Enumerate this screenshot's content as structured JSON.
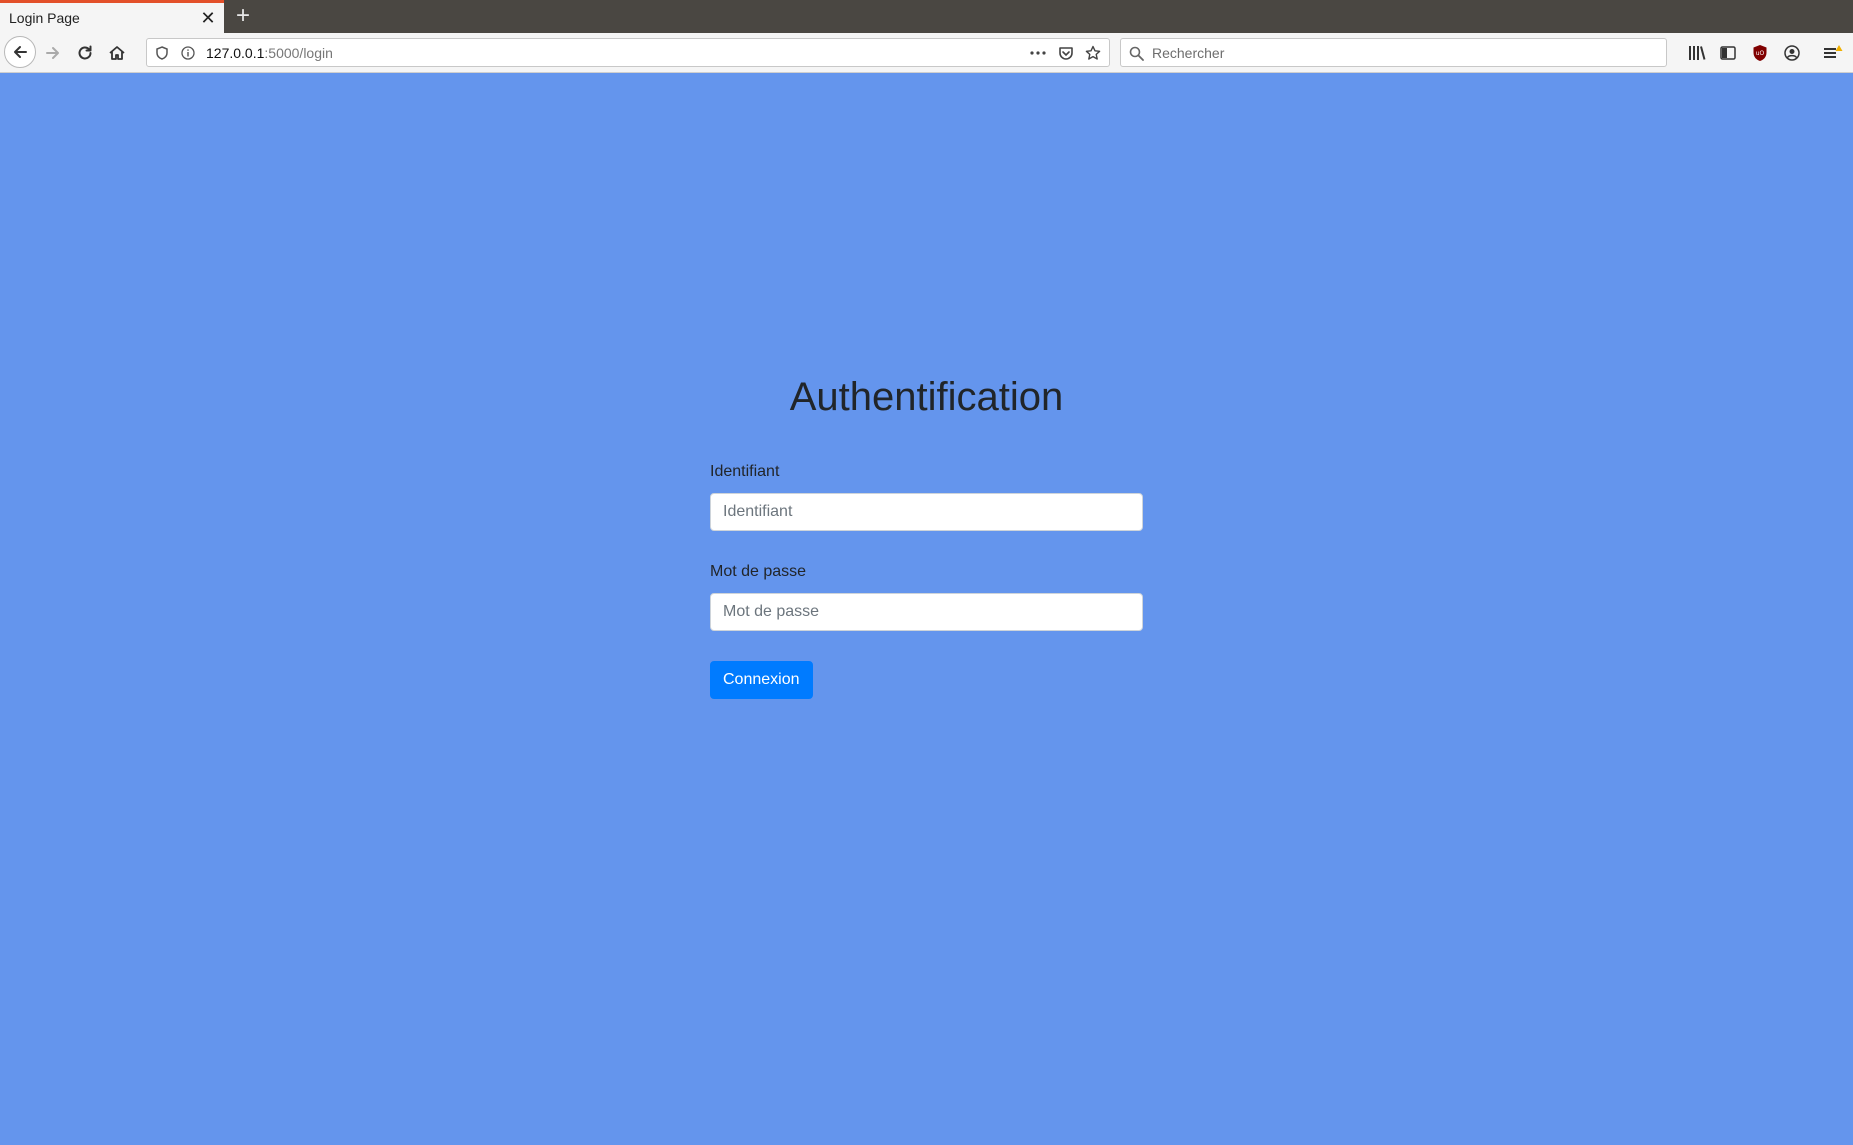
{
  "browser": {
    "tab": {
      "title": "Login Page",
      "close_glyph": "✕",
      "new_tab_glyph": "+"
    },
    "url": {
      "host": "127.0.0.1",
      "path": ":5000/login"
    },
    "search": {
      "placeholder": "Rechercher"
    },
    "colors": {
      "accent_tab_border": "#e3502a",
      "tabbar_bg": "#4a4742",
      "toolbar_bg": "#f5f5f5"
    },
    "icons": [
      "back-arrow-icon",
      "forward-arrow-icon",
      "reload-icon",
      "home-icon",
      "shield-icon",
      "info-icon",
      "more-dots-icon",
      "pocket-icon",
      "bookmark-star-icon",
      "search-icon",
      "library-icon",
      "sidebar-icon",
      "ublock-icon",
      "account-icon",
      "hamburger-menu-icon"
    ]
  },
  "page": {
    "background": "#6495ed",
    "title": "Authentification",
    "username": {
      "label": "Identifiant",
      "placeholder": "Identifiant",
      "value": ""
    },
    "password": {
      "label": "Mot de passe",
      "placeholder": "Mot de passe",
      "value": ""
    },
    "submit_label": "Connexion",
    "button_color": "#007bff"
  }
}
